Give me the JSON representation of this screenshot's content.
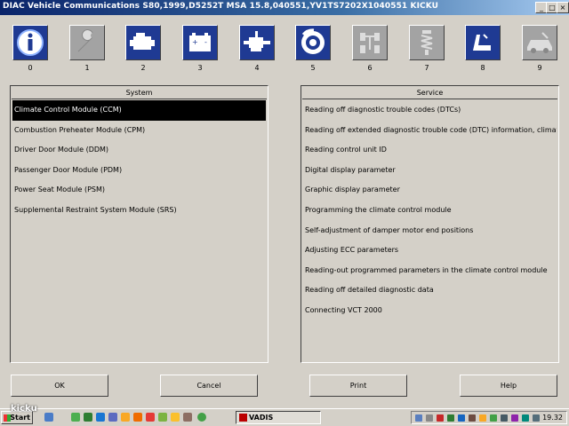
{
  "window": {
    "title": "DIAC  Vehicle Communications S80,1999,D5252T MSA 15.8,040551,YV1TS7202X1040551 KICKU",
    "controls": [
      "_",
      "□",
      "×"
    ]
  },
  "toolbar": {
    "icons": [
      {
        "number": "0",
        "name": "info-icon",
        "state": "active"
      },
      {
        "number": "1",
        "name": "wrench-icon",
        "state": "inactive"
      },
      {
        "number": "2",
        "name": "engine-icon",
        "state": "active"
      },
      {
        "number": "3",
        "name": "battery-icon",
        "state": "active"
      },
      {
        "number": "4",
        "name": "transmission-icon",
        "state": "active"
      },
      {
        "number": "5",
        "name": "brake-disc-icon",
        "state": "active"
      },
      {
        "number": "6",
        "name": "steering-icon",
        "state": "inactive"
      },
      {
        "number": "7",
        "name": "suspension-icon",
        "state": "inactive"
      },
      {
        "number": "8",
        "name": "seat-icon",
        "state": "active"
      },
      {
        "number": "9",
        "name": "body-icon",
        "state": "inactive"
      }
    ]
  },
  "system_panel": {
    "header": "System",
    "items": [
      "Climate Control Module (CCM)",
      "Combustion Preheater Module (CPM)",
      "Driver Door Module (DDM)",
      "Passenger Door Module (PDM)",
      "Power Seat Module (PSM)",
      "Supplemental Restraint System Module (SRS)"
    ],
    "selected_index": 0
  },
  "service_panel": {
    "header": "Service",
    "items": [
      "Reading off diagnostic trouble codes (DTCs)",
      "Reading off extended diagnostic trouble code (DTC) information, climate c",
      "Reading control unit ID",
      "Digital display parameter",
      "Graphic display parameter",
      "Programming the climate control module",
      "Self-adjustment of damper motor end positions",
      "Adjusting ECC parameters",
      "Reading-out programmed parameters in the climate control module",
      "Reading off detailed diagnostic data",
      "Connecting VCT 2000"
    ]
  },
  "buttons": {
    "ok": "OK",
    "cancel": "Cancel",
    "print": "Print",
    "help": "Help"
  },
  "taskbar": {
    "start": "Start",
    "task": "VADIS",
    "clock": "19.32",
    "watermark": "kicku"
  },
  "colors": {
    "active_icon_bg": "#1f3a93",
    "inactive_icon_bg": "#a3a3a3",
    "selection_bg": "#000000",
    "window_face": "#d4d0c8",
    "title_gradient_start": "#0a246a"
  }
}
